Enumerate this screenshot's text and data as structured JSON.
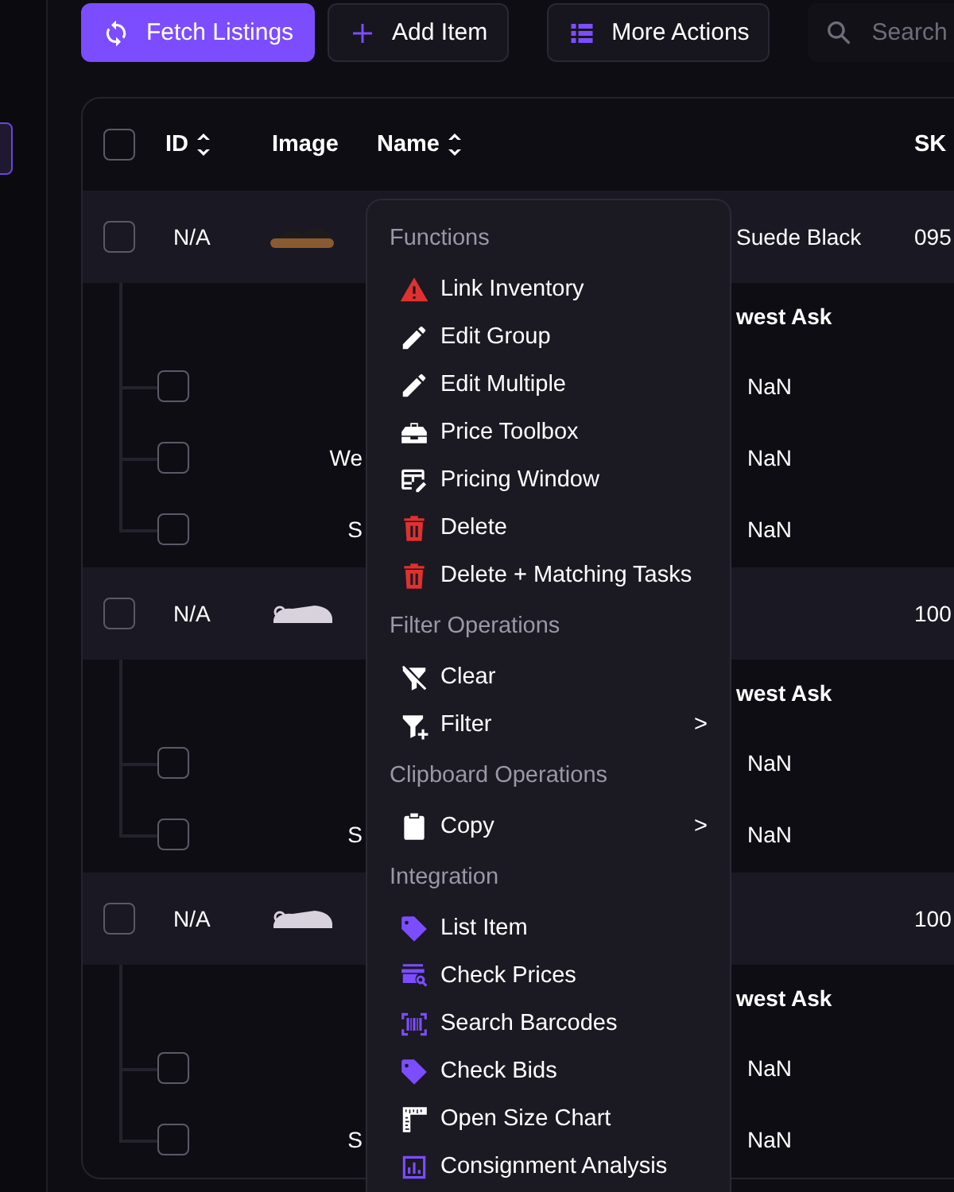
{
  "toolbar": {
    "buttons": [
      {
        "label": "Fetch Listings",
        "kind": "primary"
      },
      {
        "label": "Add Item",
        "kind": "secondary"
      },
      {
        "label": "More Actions",
        "kind": "secondary"
      }
    ],
    "search": {
      "placeholder": "Search"
    }
  },
  "table": {
    "select_all_checked": false,
    "columns": [
      {
        "label": "ID",
        "sortable": true
      },
      {
        "label": "Image",
        "sortable": false
      },
      {
        "label": "Name",
        "sortable": true
      },
      {
        "label": "SK",
        "sortable": false
      }
    ],
    "rows": [
      {
        "checked": false,
        "id": "N/A",
        "name": "Suede Black",
        "sku": "095",
        "subtable": {
          "header": "west Ask",
          "rows": [
            {
              "checked": false,
              "value": "NaN"
            },
            {
              "checked": false,
              "label": "We",
              "value": "NaN"
            },
            {
              "checked": false,
              "label": "S",
              "value": "NaN"
            }
          ]
        }
      },
      {
        "checked": false,
        "id": "N/A",
        "sku": "100",
        "subtable": {
          "header": "west Ask",
          "rows": [
            {
              "checked": false,
              "value": "NaN"
            },
            {
              "checked": false,
              "label": "S",
              "value": "NaN"
            }
          ]
        }
      },
      {
        "checked": false,
        "id": "N/A",
        "sku": "100",
        "subtable": {
          "header": "west Ask",
          "rows": [
            {
              "checked": false,
              "value": "NaN"
            },
            {
              "checked": false,
              "label": "S",
              "value": "NaN"
            }
          ]
        }
      }
    ]
  },
  "context_menu": {
    "sections": [
      {
        "title": "Functions",
        "items": [
          {
            "label": "Link Inventory",
            "color": "#e0312f"
          },
          {
            "label": "Edit Group",
            "color": "#ffffff"
          },
          {
            "label": "Edit Multiple",
            "color": "#ffffff"
          },
          {
            "label": "Price Toolbox",
            "color": "#ffffff"
          },
          {
            "label": "Pricing Window",
            "color": "#ffffff"
          },
          {
            "label": "Delete",
            "color": "#e0312f"
          },
          {
            "label": "Delete + Matching Tasks",
            "color": "#e0312f"
          }
        ]
      },
      {
        "title": "Filter Operations",
        "items": [
          {
            "label": "Clear",
            "color": "#ffffff"
          },
          {
            "label": "Filter",
            "color": "#ffffff",
            "arrow": ">"
          }
        ]
      },
      {
        "title": "Clipboard Operations",
        "items": [
          {
            "label": "Copy",
            "color": "#ffffff",
            "arrow": ">"
          }
        ]
      },
      {
        "title": "Integration",
        "items": [
          {
            "label": "List Item",
            "color": "#7c4dff"
          },
          {
            "label": "Check Prices",
            "color": "#7c4dff"
          },
          {
            "label": "Search Barcodes",
            "color": "#7c4dff"
          },
          {
            "label": "Check Bids",
            "color": "#7c4dff"
          },
          {
            "label": "Open Size Chart",
            "color": "#ffffff"
          },
          {
            "label": "Consignment Analysis",
            "color": "#7c4dff"
          }
        ]
      }
    ]
  }
}
